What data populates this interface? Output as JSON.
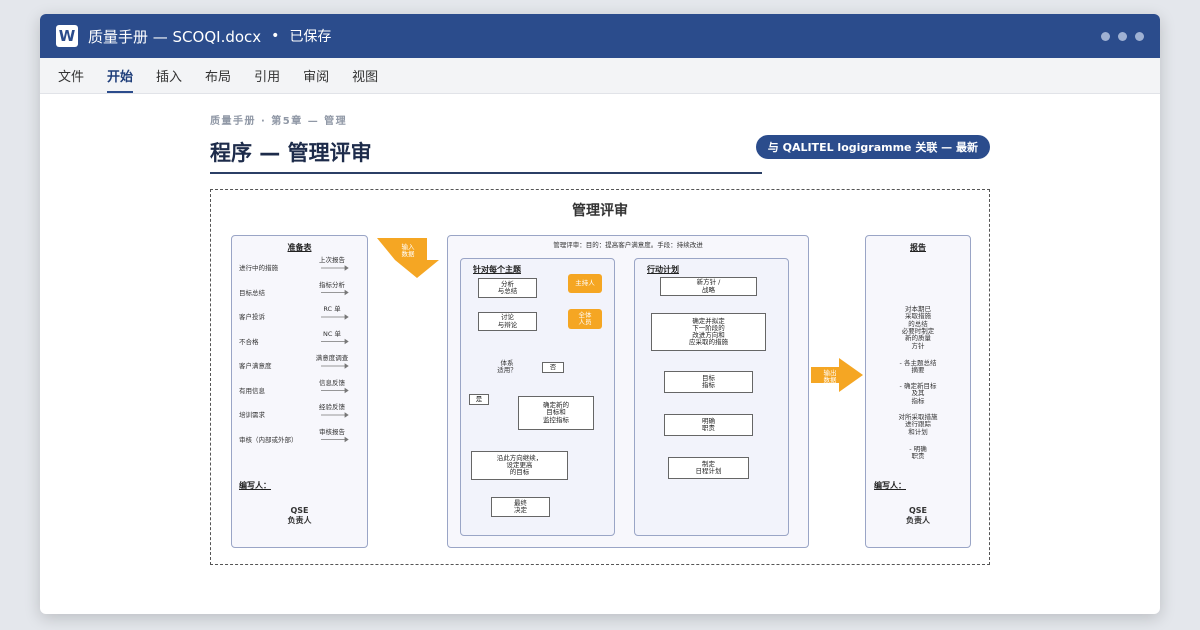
{
  "window": {
    "app_icon": "W",
    "doc_title": "质量手册 — SCOQI.docx",
    "separator": "•",
    "save_status": "已保存"
  },
  "menu": [
    "文件",
    "开始",
    "插入",
    "布局",
    "引用",
    "审阅",
    "视图"
  ],
  "active_menu": "开始",
  "page": {
    "breadcrumb": "质量手册 · 第5章 — 管理",
    "title": "程序 — 管理评审",
    "badge": "与 QALITEL logigramme 关联 — 最新"
  },
  "diagram": {
    "title": "管理评审",
    "left_panel": {
      "title": "准备表",
      "rows": [
        {
          "item": "进行中的措施",
          "source": "上次报告"
        },
        {
          "item": "目标总结",
          "source": "指标分析"
        },
        {
          "item": "客户投诉",
          "source": "RC 单"
        },
        {
          "item": "不合格",
          "source": "NC 单"
        },
        {
          "item": "客户满意度",
          "source": "满意度调查"
        },
        {
          "item": "有用信息",
          "source": "信息反馈"
        },
        {
          "item": "培训需求",
          "source": "经验反馈"
        },
        {
          "item": "审核（内部或外部）",
          "source": "审核报告"
        }
      ],
      "author_label": "编写人：",
      "author": "QSE\n负责人"
    },
    "input_arrow": "输入\n数据",
    "center_panel": {
      "header": "管理评审：目的：提高客户满意度。手段：持续改进",
      "topics": {
        "title": "针对每个主题",
        "box_analyze": "分析\n与总结",
        "tag_host": "主持人",
        "box_discuss": "讨论\n与辩论",
        "tag_all": "全体\n人员",
        "decision": "体系\n适用？",
        "no": "否",
        "yes": "是",
        "box_new_targets": "确定新的\n目标和\n监控指标",
        "box_continue": "沿此方向继续，\n设定更高\n的目标",
        "box_final": "最终\n决定"
      },
      "action": {
        "title": "行动计划",
        "box_policy": "新方针 /\n战略",
        "box_define": "确定并拟定\n下一阶段的\n改进方向和\n应采取的措施",
        "box_goal": "目标\n指标",
        "box_duty": "明确\n职责",
        "box_schedule": "制定\n日程计划"
      }
    },
    "output_arrow": "输出\n数据",
    "right_panel": {
      "title": "报告",
      "items": [
        "对本期已\n采取措施\n的总结",
        "必要时制定\n新的质量\n方针",
        "- 各主题总结\n摘要",
        "- 确定新目标\n及其\n指标",
        "对所采取措施\n进行跟踪\n和计划",
        "- 明确\n职责"
      ],
      "author_label": "编写人：",
      "author": "QSE\n负责人"
    }
  },
  "colors": {
    "titlebar": "#2b4c8c",
    "accent_orange": "#f5a623",
    "panel_border": "#9aa5c6"
  }
}
